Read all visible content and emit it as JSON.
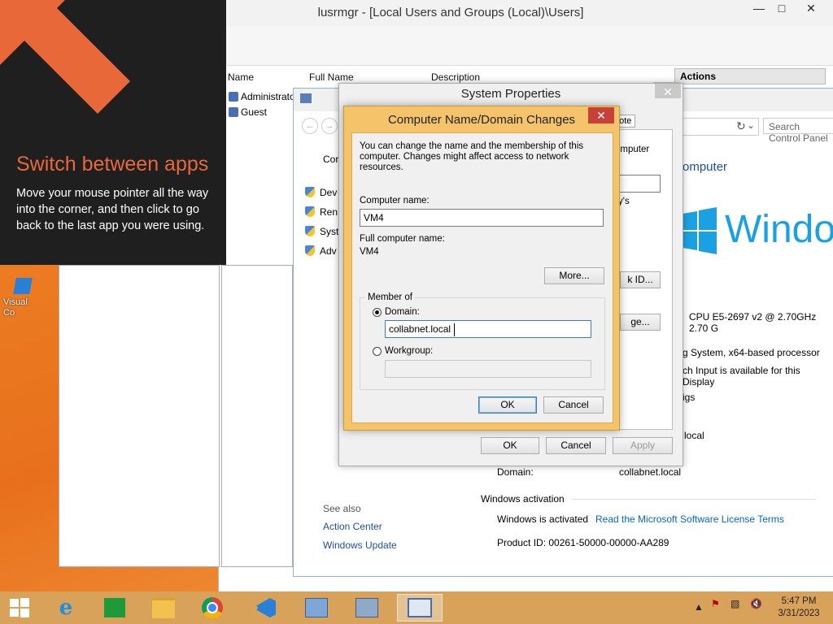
{
  "tip": {
    "title": "Switch between apps",
    "body": "Move your mouse pointer all the way into the corner, and then click to go back to the last app you were using."
  },
  "desktop_icon": {
    "label": "Visual\nCo"
  },
  "lusrmgr": {
    "title": "lusrmgr - [Local Users and Groups (Local)\\Users]",
    "columns": [
      "Name",
      "Full Name",
      "Description"
    ],
    "users": [
      "Administrator",
      "Guest"
    ],
    "actions_header": "Actions"
  },
  "system_window": {
    "search_placeholder": "Search Control Panel",
    "computer_heading": "omputer",
    "links": [
      "Dev",
      "Ren",
      "Syst",
      "Adv"
    ],
    "com_label": "Cor",
    "windows_text": "Windo",
    "cpu": "CPU E5-2697 v2 @ 2.70GHz   2.70 G",
    "system_type": "g System, x64-based processor",
    "pen": "ch Input is available for this Display",
    "settings": "igs",
    "local": "local",
    "domain_label": "Domain:",
    "domain_value": "collabnet.local",
    "activation_heading": "Windows activation",
    "activation_status": "Windows is activated",
    "license_link": "Read the Microsoft Software License Terms",
    "product_id": "Product ID:  00261-50000-00000-AA289",
    "see_also": "See also",
    "see_also_links": [
      "Action Center",
      "Windows Update"
    ]
  },
  "system_properties": {
    "title": "System Properties",
    "remote_tab": "note",
    "computer_frag": "omputer",
    "ys": "y's",
    "network_id_button": "k ID...",
    "change_button": "ge...",
    "ok": "OK",
    "cancel": "Cancel",
    "apply": "Apply"
  },
  "cn_dialog": {
    "title": "Computer Name/Domain Changes",
    "intro": "You can change the name and the membership of this computer. Changes might affect access to network resources.",
    "computer_name_label": "Computer name:",
    "computer_name_value": "VM4",
    "full_name_label": "Full computer name:",
    "full_name_value": "VM4",
    "more_button": "More...",
    "member_of": "Member of",
    "domain_label": "Domain:",
    "domain_value": "collabnet.local",
    "workgroup_label": "Workgroup:",
    "workgroup_value": "",
    "ok": "OK",
    "cancel": "Cancel"
  },
  "taskbar": {
    "time": "5:47 PM",
    "date": "3/31/2023"
  }
}
